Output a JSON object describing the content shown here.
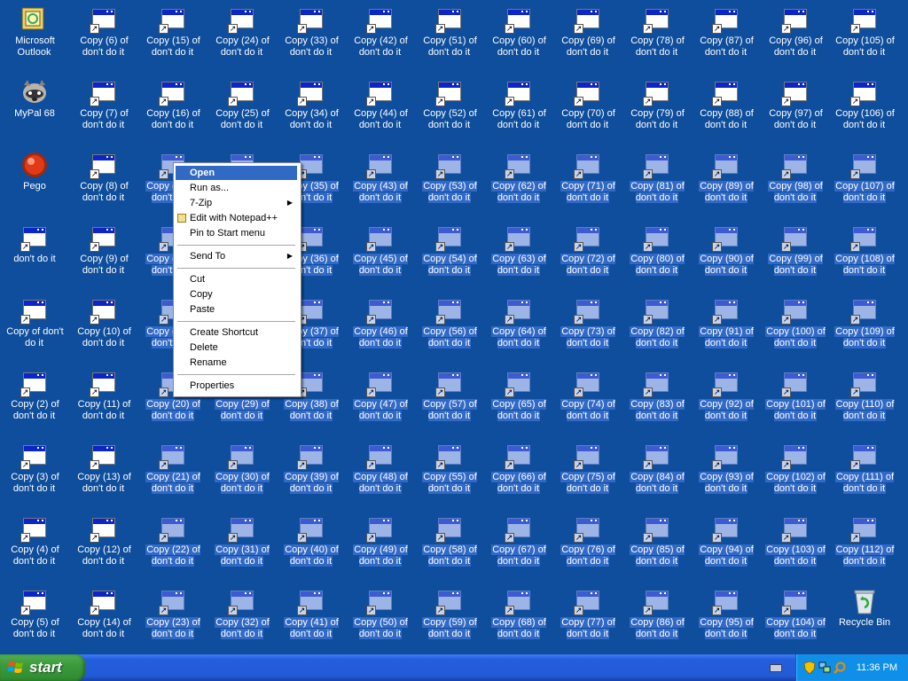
{
  "desktop": {
    "col1": [
      {
        "label": "Microsoft Outlook",
        "icon": "outlook-icon"
      },
      {
        "label": "MyPal 68",
        "icon": "mypal-icon"
      },
      {
        "label": "Pego",
        "icon": "pego-icon"
      },
      {
        "label": "don't do it",
        "icon": "window-shortcut-icon"
      },
      {
        "label": "Copy of don't do it",
        "icon": "window-shortcut-icon"
      },
      {
        "label": "Copy (2) of don't do it",
        "icon": "window-shortcut-icon"
      },
      {
        "label": "Copy (3) of don't do it",
        "icon": "window-shortcut-icon"
      },
      {
        "label": "Copy (4) of don't do it",
        "icon": "window-shortcut-icon"
      },
      {
        "label": "Copy (5) of don't do it",
        "icon": "window-shortcut-icon"
      }
    ],
    "grid": [
      [
        "6",
        "7",
        "8",
        "9",
        "10",
        "11",
        "13",
        "12",
        "14"
      ],
      [
        "15",
        "16",
        "17",
        "18",
        "19",
        "20",
        "21",
        "22",
        "23"
      ],
      [
        "24",
        "25",
        "26",
        "27",
        "28",
        "29",
        "30",
        "31",
        "32"
      ],
      [
        "33",
        "34",
        "35",
        "36",
        "37",
        "38",
        "39",
        "40",
        "41"
      ],
      [
        "42",
        "44",
        "43",
        "45",
        "46",
        "47",
        "48",
        "49",
        "50"
      ],
      [
        "51",
        "52",
        "53",
        "54",
        "56",
        "57",
        "55",
        "58",
        "59"
      ],
      [
        "60",
        "61",
        "62",
        "63",
        "64",
        "65",
        "66",
        "67",
        "68"
      ],
      [
        "69",
        "70",
        "71",
        "72",
        "73",
        "74",
        "75",
        "76",
        "77"
      ],
      [
        "78",
        "79",
        "81",
        "80",
        "82",
        "83",
        "84",
        "85",
        "86"
      ],
      [
        "87",
        "88",
        "89",
        "90",
        "91",
        "92",
        "93",
        "94",
        "95"
      ],
      [
        "96",
        "97",
        "98",
        "99",
        "100",
        "101",
        "102",
        "103",
        "104"
      ],
      [
        "105",
        "106",
        "107",
        "108",
        "109",
        "110",
        "111",
        "112",
        ""
      ]
    ],
    "label_prefix": "Copy (",
    "label_suffix": ") of don't do it",
    "recycle_bin": "Recycle Bin"
  },
  "context_menu": {
    "items": [
      {
        "label": "Open",
        "highlight": true
      },
      {
        "label": "Run as...",
        "highlight": false
      },
      {
        "label": "7-Zip",
        "submenu": true
      },
      {
        "label": "Edit with Notepad++",
        "icon": "notepadpp-icon"
      },
      {
        "label": "Pin to Start menu"
      },
      {
        "sep": true
      },
      {
        "label": "Send To",
        "submenu": true
      },
      {
        "sep": true
      },
      {
        "label": "Cut"
      },
      {
        "label": "Copy"
      },
      {
        "label": "Paste"
      },
      {
        "sep": true
      },
      {
        "label": "Create Shortcut"
      },
      {
        "label": "Delete"
      },
      {
        "label": "Rename"
      },
      {
        "sep": true
      },
      {
        "label": "Properties"
      }
    ]
  },
  "taskbar": {
    "start_label": "start",
    "clock": "11:36 PM",
    "tray_icons": [
      "keyboard-icon",
      "security-shield-icon",
      "network-icon",
      "search-icon"
    ]
  },
  "colors": {
    "desktop": "#0e4e9d",
    "selection": "#3169c6",
    "menu_highlight": "#316ac5",
    "taskbar": "#245edc",
    "start": "#3c9a3c",
    "tray": "#0f8fe8"
  }
}
